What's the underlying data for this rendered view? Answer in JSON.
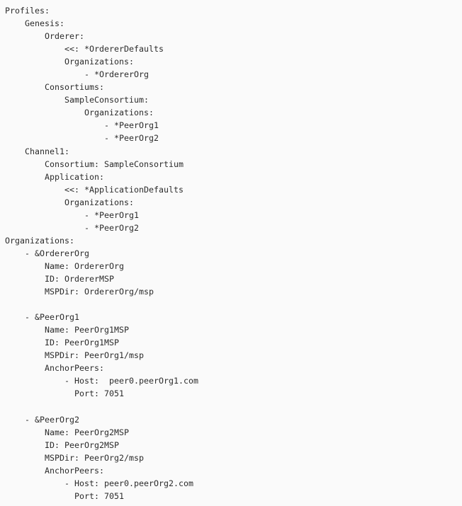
{
  "document": {
    "type": "yaml-text-file",
    "font_family": "monospace",
    "background_color": "#fafafa",
    "text_color": "#2b2b2b",
    "line_count": 39,
    "lines": [
      "Profiles:",
      "    Genesis:",
      "        Orderer:",
      "            <<: *OrdererDefaults",
      "            Organizations:",
      "                - *OrdererOrg",
      "        Consortiums:",
      "            SampleConsortium:",
      "                Organizations:",
      "                    - *PeerOrg1",
      "                    - *PeerOrg2",
      "    Channel1:",
      "        Consortium: SampleConsortium",
      "        Application:",
      "            <<: *ApplicationDefaults",
      "            Organizations:",
      "                - *PeerOrg1",
      "                - *PeerOrg2",
      "Organizations:",
      "    - &OrdererOrg",
      "        Name: OrdererOrg",
      "        ID: OrdererMSP",
      "        MSPDir: OrdererOrg/msp",
      "",
      "    - &PeerOrg1",
      "        Name: PeerOrg1MSP",
      "        ID: PeerOrg1MSP",
      "        MSPDir: PeerOrg1/msp",
      "        AnchorPeers:",
      "            - Host:  peer0.peerOrg1.com",
      "              Port: 7051",
      "",
      "    - &PeerOrg2",
      "        Name: PeerOrg2MSP",
      "        ID: PeerOrg2MSP",
      "        MSPDir: PeerOrg2/msp",
      "        AnchorPeers:",
      "            - Host: peer0.peerOrg2.com",
      "              Port: 7051"
    ]
  }
}
